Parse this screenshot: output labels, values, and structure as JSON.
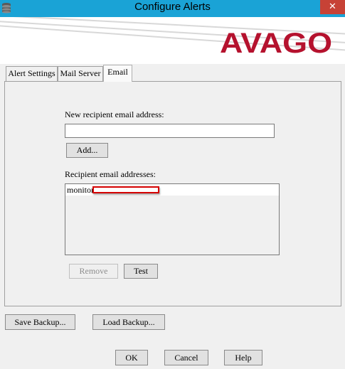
{
  "window": {
    "title": "Configure Alerts",
    "close_glyph": "✕"
  },
  "banner": {
    "logo_text": "AVAGO",
    "logo_color": "#b5122e"
  },
  "tabs": [
    {
      "label": "Alert Settings",
      "active": false
    },
    {
      "label": "Mail Server",
      "active": false
    },
    {
      "label": "Email",
      "active": true
    }
  ],
  "email": {
    "new_recipient_label": "New recipient email address:",
    "new_recipient_value": "",
    "add_button": "Add...",
    "recipients_label": "Recipient email addresses:",
    "recipients": [
      "monitor"
    ],
    "remove_button": "Remove",
    "test_button": "Test"
  },
  "footer": {
    "save_backup": "Save Backup...",
    "load_backup": "Load Backup...",
    "ok": "OK",
    "cancel": "Cancel",
    "help": "Help"
  },
  "icons": [
    "database-icon",
    "close-icon"
  ]
}
